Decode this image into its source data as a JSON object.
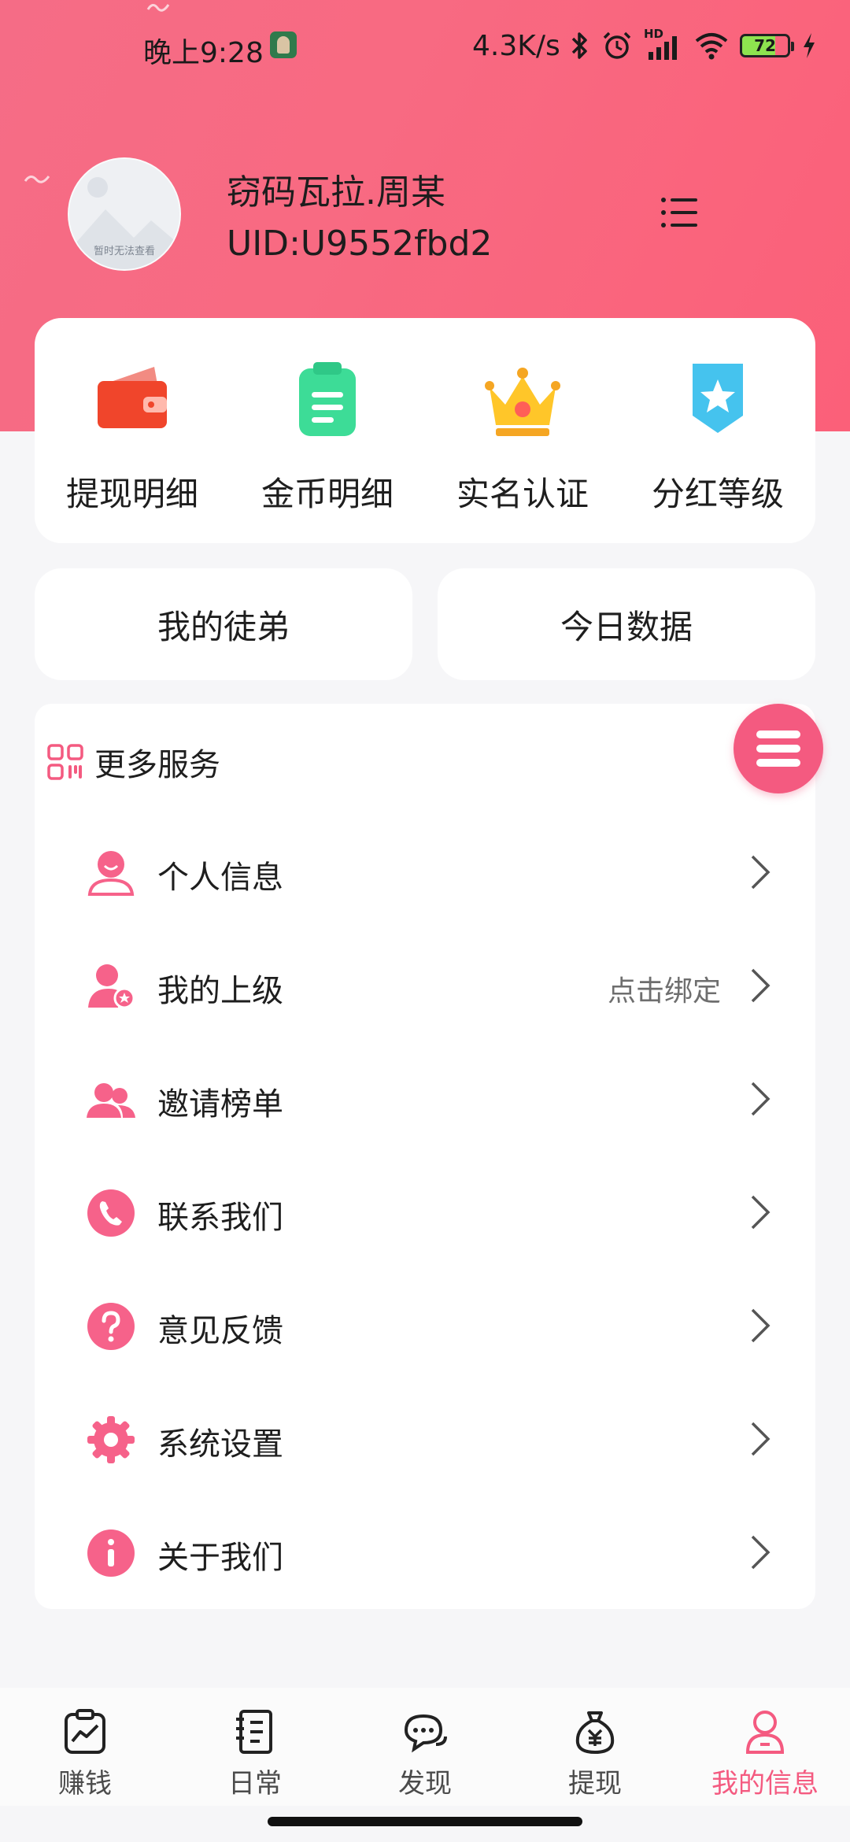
{
  "status_bar": {
    "time": "晚上9:28",
    "network_speed": "4.3K/s",
    "hd_label": "HD",
    "battery": "72",
    "icons": [
      "bluetooth-icon",
      "alarm-icon",
      "signal-icon",
      "wifi-icon",
      "battery-icon",
      "charging-icon"
    ]
  },
  "profile": {
    "avatar_caption": "暂时无法查看",
    "name": "窃码瓦拉.周某",
    "uid": "UID:U9552fbd2"
  },
  "quick_actions": [
    {
      "label": "提现明细",
      "icon": "wallet-icon"
    },
    {
      "label": "金币明细",
      "icon": "clipboard-icon"
    },
    {
      "label": "实名认证",
      "icon": "crown-icon"
    },
    {
      "label": "分红等级",
      "icon": "star-badge-icon"
    }
  ],
  "cards": {
    "apprentice": "我的徒弟",
    "today_data": "今日数据"
  },
  "services": {
    "title": "更多服务",
    "items": [
      {
        "label": "个人信息",
        "icon": "user-icon",
        "value": ""
      },
      {
        "label": "我的上级",
        "icon": "user-award-icon",
        "value": "点击绑定"
      },
      {
        "label": "邀请榜单",
        "icon": "users-icon",
        "value": ""
      },
      {
        "label": "联系我们",
        "icon": "phone-icon",
        "value": ""
      },
      {
        "label": "意见反馈",
        "icon": "question-icon",
        "value": ""
      },
      {
        "label": "系统设置",
        "icon": "gear-icon",
        "value": ""
      },
      {
        "label": "关于我们",
        "icon": "info-icon",
        "value": ""
      }
    ]
  },
  "bottom_nav": [
    {
      "label": "赚钱",
      "icon": "chart-icon",
      "active": false
    },
    {
      "label": "日常",
      "icon": "notebook-icon",
      "active": false
    },
    {
      "label": "发现",
      "icon": "chat-icon",
      "active": false
    },
    {
      "label": "提现",
      "icon": "money-bag-icon",
      "active": false
    },
    {
      "label": "我的信息",
      "icon": "profile-icon",
      "active": true
    }
  ],
  "colors": {
    "accent": "#f45a80",
    "hero_start": "#f56c86",
    "hero_end": "#fb6079",
    "background": "#f6f6f8"
  }
}
